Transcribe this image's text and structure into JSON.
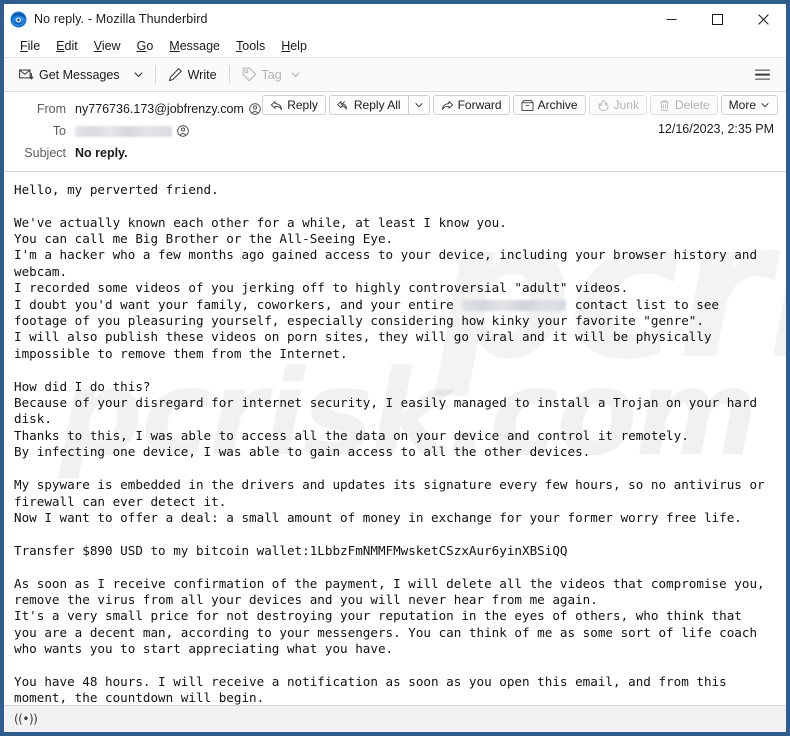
{
  "window": {
    "title": "No reply. - Mozilla Thunderbird",
    "logo_icon": "thunderbird-logo-icon",
    "minimize_label": "Minimize",
    "maximize_label": "Maximize",
    "close_label": "Close",
    "border_color": "#2f5d8e"
  },
  "menubar": {
    "items": [
      {
        "label": "File",
        "accesskey": "F"
      },
      {
        "label": "Edit",
        "accesskey": "E"
      },
      {
        "label": "View",
        "accesskey": "V"
      },
      {
        "label": "Go",
        "accesskey": "G"
      },
      {
        "label": "Message",
        "accesskey": "M"
      },
      {
        "label": "Tools",
        "accesskey": "T"
      },
      {
        "label": "Help",
        "accesskey": "H"
      }
    ]
  },
  "toolbar": {
    "get_messages_label": "Get Messages",
    "get_messages_icon": "envelope-download-icon",
    "get_messages_chevron_icon": "chevron-down-icon",
    "write_label": "Write",
    "write_icon": "pencil-icon",
    "tag_label": "Tag",
    "tag_icon": "tag-icon",
    "tag_chevron_icon": "chevron-down-icon",
    "tag_disabled": true,
    "app_menu_icon": "hamburger-menu-icon"
  },
  "message_actions": {
    "reply_label": "Reply",
    "reply_icon": "reply-arrow-icon",
    "reply_all_label": "Reply All",
    "reply_all_icon": "reply-all-arrow-icon",
    "reply_all_chevron_icon": "chevron-down-icon",
    "forward_label": "Forward",
    "forward_icon": "forward-arrow-icon",
    "archive_label": "Archive",
    "archive_icon": "archive-box-icon",
    "junk_label": "Junk",
    "junk_icon": "junk-flame-icon",
    "junk_disabled": true,
    "delete_label": "Delete",
    "delete_icon": "trash-can-icon",
    "delete_disabled": true,
    "more_label": "More",
    "more_chevron_icon": "chevron-down-icon"
  },
  "message_header": {
    "from_label": "From",
    "from_value": "ny776736.173@jobfrenzy.com",
    "from_contact_icon": "contact-card-icon",
    "to_label": "To",
    "to_value": "",
    "to_redacted": true,
    "to_contact_icon": "contact-card-icon",
    "subject_label": "Subject",
    "subject_value": "No reply.",
    "date": "12/16/2023, 2:35 PM"
  },
  "message_body": {
    "watermark_text": "pcrisk.com",
    "part1": "Hello, my perverted friend.\n\nWe've actually known each other for a while, at least I know you.\nYou can call me Big Brother or the All-Seeing Eye.\nI'm a hacker who a few months ago gained access to your device, including your browser history and\nwebcam.\nI recorded some videos of you jerking off to highly controversial \"adult\" videos.\nI doubt you'd want your family, coworkers, and your entire ",
    "part2": " contact list to see\nfootage of you pleasuring yourself, especially considering how kinky your favorite \"genre\".\nI will also publish these videos on porn sites, they will go viral and it will be physically\nimpossible to remove them from the Internet.\n\nHow did I do this?\nBecause of your disregard for internet security, I easily managed to install a Trojan on your hard\ndisk.\nThanks to this, I was able to access all the data on your device and control it remotely.\nBy infecting one device, I was able to gain access to all the other devices.\n\nMy spyware is embedded in the drivers and updates its signature every few hours, so no antivirus or\nfirewall can ever detect it.\nNow I want to offer a deal: a small amount of money in exchange for your former worry free life.\n\nTransfer $890 USD to my bitcoin wallet:1LbbzFmNMMFMwsketCSzxAur6yinXBSiQQ\n\nAs soon as I receive confirmation of the payment, I will delete all the videos that compromise you,\nremove the virus from all your devices and you will never hear from me again.\nIt's a very small price for not destroying your reputation in the eyes of others, who think that\nyou are a decent man, according to your messengers. You can think of me as some sort of life coach\nwho wants you to start appreciating what you have.\n\nYou have 48 hours. I will receive a notification as soon as you open this email, and from this\nmoment, the countdown will begin.",
    "ransom_amount": "$890 USD",
    "bitcoin_wallet": "1LbbzFmNMMFMwsketCSzxAur6yinXBSiQQ",
    "deadline_hours": "48 hours"
  },
  "statusbar": {
    "connection_icon": "network-connectivity-icon",
    "connection_glyph": "((•))"
  }
}
